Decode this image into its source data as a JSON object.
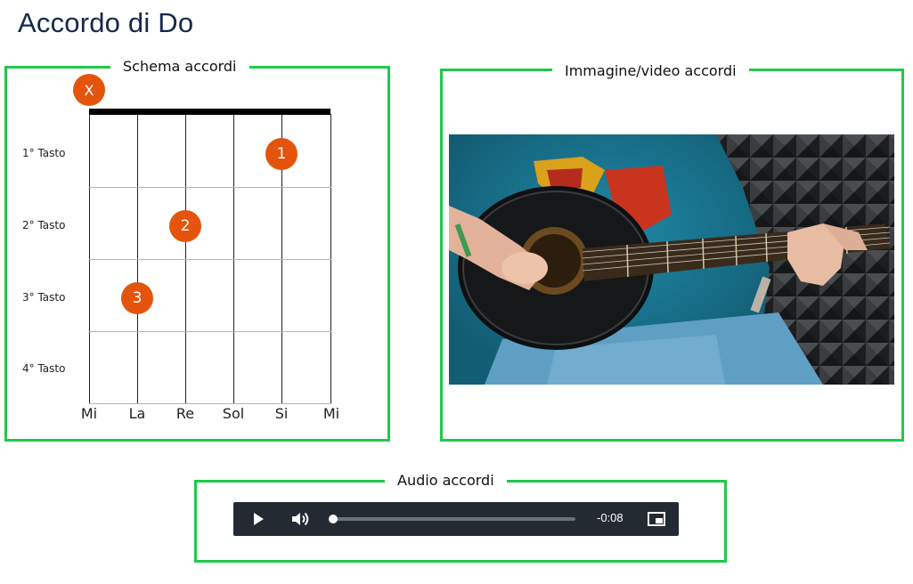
{
  "page": {
    "title": "Accordo di Do"
  },
  "schema": {
    "legend": "Schema accordi",
    "muted_symbol": "X",
    "frets": [
      "1° Tasto",
      "2° Tasto",
      "3° Tasto",
      "4° Tasto"
    ],
    "strings": [
      "Mi",
      "La",
      "Re",
      "Sol",
      "Si",
      "Mi"
    ],
    "fingers": [
      {
        "label": "1",
        "string": "Si",
        "fret": 1
      },
      {
        "label": "2",
        "string": "Re",
        "fret": 2
      },
      {
        "label": "3",
        "string": "La",
        "fret": 3
      }
    ],
    "muted_string": "Mi",
    "marker_color": "#e4540c"
  },
  "media": {
    "legend": "Immagine/video accordi"
  },
  "audio": {
    "legend": "Audio accordi",
    "time": "-0:08",
    "progress": 0.0,
    "icons": [
      "play-icon",
      "volume-icon",
      "picture-in-picture-icon"
    ]
  },
  "colors": {
    "frame": "#20c94a",
    "title": "#14284b",
    "player_bg": "#242a31"
  }
}
